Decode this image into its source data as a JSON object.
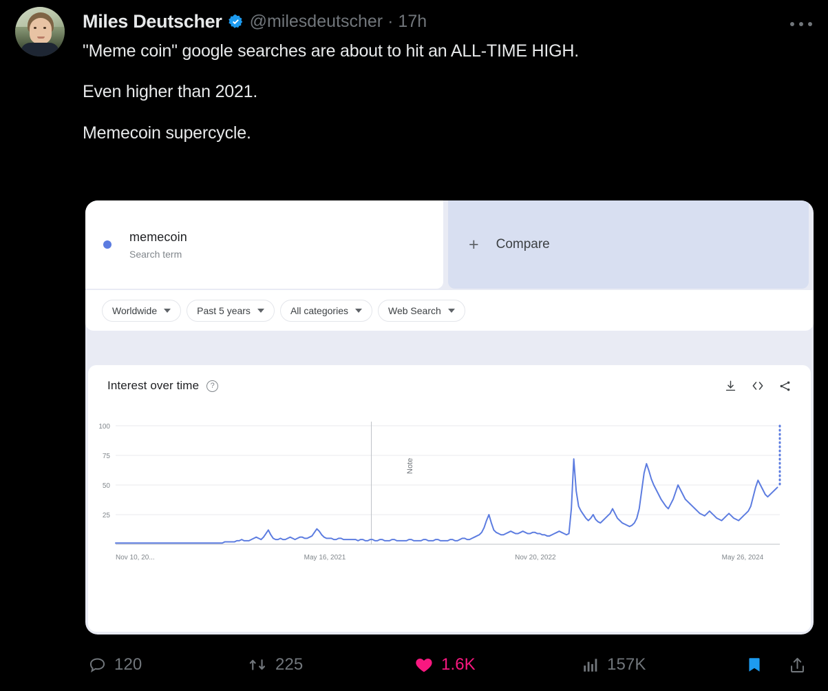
{
  "tweet": {
    "author_name": "Miles Deutscher",
    "verified_badge": "verified-badge",
    "handle": "@milesdeutscher",
    "separator": "·",
    "timestamp": "17h",
    "more_menu": "more-options",
    "lines": [
      "\"Meme coin\" google searches are about to hit an ALL-TIME HIGH.",
      "Even higher than 2021.",
      "Memecoin supercycle."
    ]
  },
  "engagement": {
    "reply_count": "120",
    "retweet_count": "225",
    "like_count": "1.6K",
    "views_count": "157K",
    "bookmark_icon": "bookmark-icon",
    "share_icon": "share-icon",
    "like_color": "#f91880",
    "bookmark_color": "#1d9bf0",
    "muted_color": "#71767b"
  },
  "trends": {
    "term": {
      "name": "memecoin",
      "subtitle": "Search term",
      "dot_color": "#5c7ce0"
    },
    "compare": {
      "plus": "+",
      "label": "Compare"
    },
    "filters": [
      {
        "label": "Worldwide"
      },
      {
        "label": "Past 5 years"
      },
      {
        "label": "All categories"
      },
      {
        "label": "Web Search"
      }
    ],
    "chart_header": {
      "title": "Interest over time",
      "help_glyph": "?",
      "actions": [
        {
          "name": "download-icon"
        },
        {
          "name": "embed-icon"
        },
        {
          "name": "share-icon"
        }
      ]
    }
  },
  "chart_data": {
    "type": "line",
    "title": "Interest over time",
    "xlabel": "",
    "ylabel": "",
    "ylim": [
      0,
      100
    ],
    "grid": true,
    "legend": "none",
    "series_color": "#5c7ce0",
    "annotation": {
      "text": "Note",
      "x_position": "May 2022",
      "orientation": "vertical"
    },
    "partial_data_marker": {
      "style": "dotted-vertical",
      "value": 100,
      "at": "end"
    },
    "xticks": [
      "Nov 10, 20...",
      "May 16, 2021",
      "Nov 20, 2022",
      "May 26, 2024"
    ],
    "yticks": [
      0,
      25,
      50,
      75,
      100
    ],
    "x_range": [
      "Nov 10, 2019",
      "Nov 2024"
    ],
    "series": [
      {
        "name": "memecoin",
        "values": [
          1,
          1,
          1,
          1,
          1,
          1,
          1,
          1,
          1,
          1,
          1,
          1,
          1,
          1,
          1,
          1,
          1,
          1,
          1,
          1,
          1,
          1,
          1,
          1,
          1,
          1,
          1,
          1,
          1,
          1,
          1,
          1,
          1,
          1,
          1,
          1,
          1,
          1,
          1,
          1,
          1,
          1,
          1,
          1,
          1,
          2,
          2,
          2,
          2,
          2,
          3,
          3,
          4,
          3,
          3,
          3,
          4,
          5,
          6,
          5,
          4,
          6,
          9,
          12,
          8,
          5,
          4,
          4,
          5,
          4,
          4,
          5,
          6,
          5,
          4,
          5,
          6,
          6,
          5,
          5,
          6,
          7,
          10,
          13,
          11,
          8,
          6,
          5,
          5,
          5,
          4,
          4,
          5,
          5,
          4,
          4,
          4,
          4,
          4,
          4,
          3,
          4,
          4,
          3,
          3,
          4,
          4,
          3,
          3,
          4,
          4,
          3,
          3,
          3,
          4,
          4,
          3,
          3,
          3,
          3,
          3,
          4,
          4,
          3,
          3,
          3,
          3,
          4,
          4,
          3,
          3,
          3,
          4,
          4,
          3,
          3,
          3,
          3,
          4,
          4,
          3,
          3,
          4,
          5,
          5,
          4,
          4,
          5,
          6,
          7,
          8,
          10,
          14,
          20,
          25,
          18,
          12,
          10,
          9,
          8,
          8,
          9,
          10,
          11,
          10,
          9,
          9,
          10,
          11,
          10,
          9,
          9,
          10,
          10,
          9,
          9,
          8,
          8,
          7,
          7,
          8,
          9,
          10,
          11,
          10,
          9,
          8,
          9,
          30,
          72,
          45,
          32,
          28,
          25,
          22,
          20,
          22,
          25,
          21,
          19,
          18,
          20,
          22,
          24,
          26,
          30,
          26,
          22,
          20,
          18,
          17,
          16,
          15,
          16,
          18,
          22,
          30,
          45,
          60,
          68,
          62,
          55,
          50,
          46,
          42,
          38,
          35,
          32,
          30,
          34,
          38,
          44,
          50,
          46,
          42,
          38,
          36,
          34,
          32,
          30,
          28,
          26,
          25,
          24,
          26,
          28,
          26,
          24,
          22,
          21,
          20,
          22,
          24,
          26,
          24,
          22,
          21,
          20,
          22,
          24,
          26,
          28,
          32,
          40,
          48,
          54,
          50,
          46,
          42,
          40,
          42,
          44,
          46,
          48,
          100
        ]
      }
    ]
  }
}
